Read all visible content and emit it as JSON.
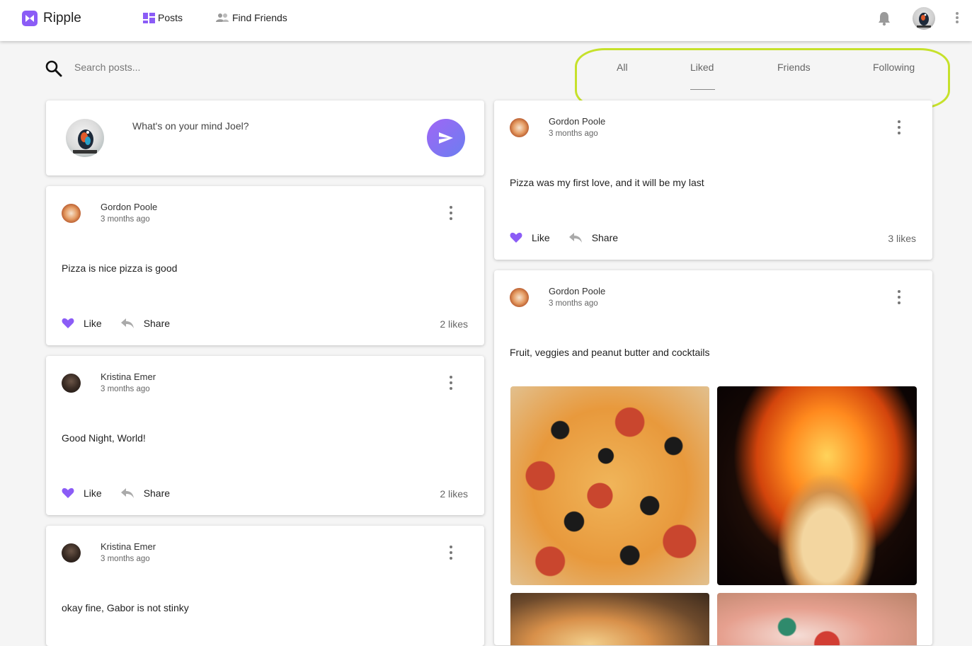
{
  "app": {
    "name": "Ripple",
    "accent": "#8b5cf6"
  },
  "nav": {
    "posts_label": "Posts",
    "find_friends_label": "Find Friends"
  },
  "search": {
    "placeholder": "Search posts..."
  },
  "tabs": {
    "items": [
      "All",
      "Liked",
      "Friends",
      "Following"
    ],
    "active": "Liked"
  },
  "composer": {
    "prompt": "What's on your mind Joel?"
  },
  "actions": {
    "like_label": "Like",
    "share_label": "Share"
  },
  "left_posts": [
    {
      "author": "Gordon Poole",
      "time": "3 months ago",
      "body": "Pizza is nice pizza is good",
      "likes": "2 likes"
    },
    {
      "author": "Kristina Emer",
      "time": "3 months ago",
      "body": "Good Night, World!",
      "likes": "2 likes"
    },
    {
      "author": "Kristina Emer",
      "time": "3 months ago",
      "body": "okay fine, Gabor is not stinky"
    }
  ],
  "right_posts": [
    {
      "author": "Gordon Poole",
      "time": "3 months ago",
      "body": "Pizza was my first love, and it will be my last",
      "likes": "3 likes"
    },
    {
      "author": "Gordon Poole",
      "time": "3 months ago",
      "body": "Fruit, veggies and peanut butter and cocktails"
    }
  ],
  "icons": [
    "ripple-logo-icon",
    "posts-icon",
    "friends-icon",
    "bell-icon",
    "search-icon",
    "send-icon",
    "heart-icon",
    "reply-icon",
    "more-vert-icon"
  ],
  "colors": {
    "like": "#8b5cf6",
    "highlight": "#c6e12b"
  }
}
